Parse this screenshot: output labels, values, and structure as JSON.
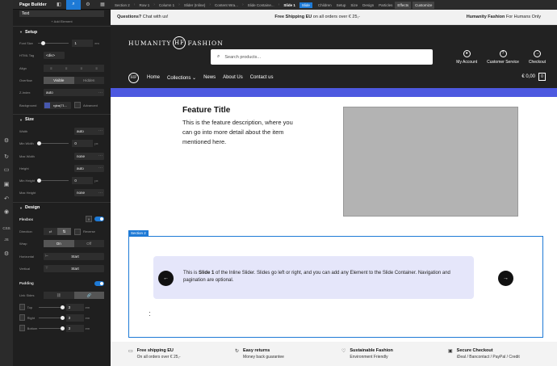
{
  "builder": {
    "title": "Page Builder",
    "text_field_value": "Text",
    "add_element": "+ Add Element",
    "setup": {
      "heading": "Setup",
      "font_size_label": "Font Size",
      "font_size_value": "1",
      "font_size_unit": "em",
      "html_tag_label": "HTML Tag",
      "html_tag_value": "<div>",
      "align_label": "Align",
      "overflow_label": "Overflow",
      "overflow_visible": "Visible",
      "overflow_hidden": "Hidden",
      "zindex_label": "Z-Index",
      "zindex_value": "auto",
      "background_label": "Background",
      "background_value": "rgba(71...",
      "advanced_label": "Advanced"
    },
    "size": {
      "heading": "Size",
      "width_label": "Width",
      "width_value": "auto",
      "min_width_label": "Min Width",
      "min_width_value": "0",
      "min_width_unit": "px",
      "max_width_label": "Max Width",
      "max_width_value": "none",
      "height_label": "Height",
      "height_value": "auto",
      "min_height_label": "Min Height",
      "min_height_value": "0",
      "min_height_unit": "px",
      "max_height_label": "Max Height",
      "max_height_value": "none"
    },
    "design": {
      "heading": "Design",
      "flexbox_label": "Flexbox",
      "direction_label": "Direction",
      "reverse_label": "Reverse",
      "wrap_label": "Wrap",
      "wrap_on": "On",
      "wrap_off": "Off",
      "horizontal_label": "Horizontal",
      "horizontal_value": "Start",
      "vertical_label": "Vertical",
      "vertical_value": "Start",
      "padding_label": "Padding",
      "link_sides_label": "Link Sides",
      "top_label": "Top",
      "top_value": "3",
      "right_label": "Right",
      "right_value": "3",
      "bottom_label": "Bottom",
      "bottom_value": "3",
      "padding_unit": "em"
    }
  },
  "topbar": {
    "crumbs": [
      "Section 2",
      "Row 1",
      "Column 1",
      "Slider (Inline)",
      "Content Wra...",
      "Slide Containe...",
      "Slide 1"
    ],
    "tag": "Slide",
    "tabs": [
      "Children",
      "Setup",
      "Size",
      "Design",
      "Particles",
      "Effects",
      "Customize"
    ]
  },
  "site": {
    "announce_left_bold": "Questions?",
    "announce_left": "Chat with us!",
    "announce_mid_bold": "Free Shipping EU",
    "announce_mid": "on all orders over € 25,-",
    "announce_right_bold": "Humanity Fashion",
    "announce_right": "For Humans Only",
    "logo_left": "HUMANITY",
    "logo_mark": "HF",
    "logo_right": "FASHION",
    "search_placeholder": "Search products...",
    "account_label": "My Account",
    "service_label": "Customer Service",
    "checkout_label": "Checkout",
    "nav": [
      "Home",
      "Collections ⌄",
      "News",
      "About Us",
      "Contact us"
    ],
    "cart_total": "€ 0,00",
    "cart_count": "0",
    "feature_title": "Feature Title",
    "feature_desc": "This is the feature description, where you can go into more detail about the item mentioned here.",
    "section_tag": "Section 2",
    "slide_text_a": "This is ",
    "slide_text_bold": "Slide 1",
    "slide_text_b": " of the Inline Slider. Slides go left or right, and you can add any Element to the Slide Container. Navigation and pagination are optional.",
    "footer": [
      {
        "icon": "truck-icon",
        "title": "Free shipping EU",
        "sub": "On all orders over € 25,-"
      },
      {
        "icon": "return-icon",
        "title": "Easy returns",
        "sub": "Money back guarantee"
      },
      {
        "icon": "heart-icon",
        "title": "Sustainable Fashion",
        "sub": "Environment Friendly"
      },
      {
        "icon": "lock-icon",
        "title": "Secure Checkout",
        "sub": "iDeal / Bancontact / PayPal / Credit"
      }
    ]
  },
  "colors": {
    "accent": "#1e7ad6",
    "header_bg": "#222222",
    "band": "#4d59e0",
    "slide_bg": "#e5e6fa"
  }
}
